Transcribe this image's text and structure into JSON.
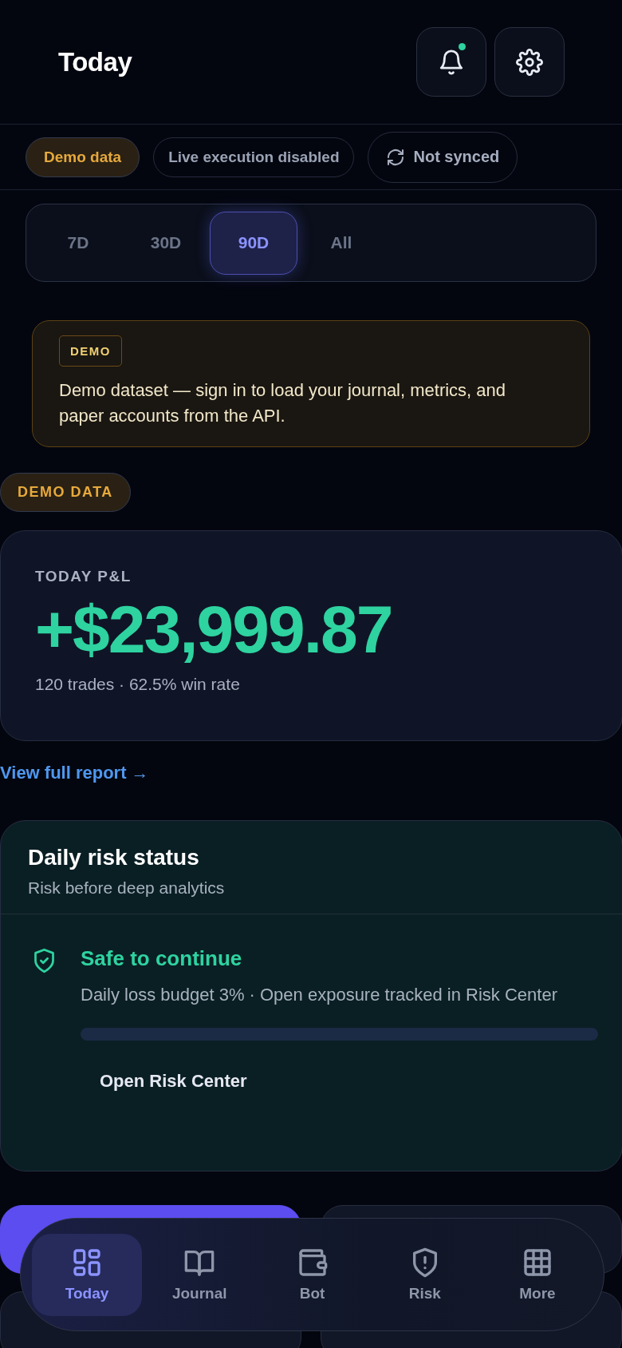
{
  "header": {
    "title": "Today",
    "notifications_unread": true
  },
  "status_chips": [
    {
      "kind": "demo",
      "label": "Demo data"
    },
    {
      "kind": "plain",
      "label": "Live execution disabled"
    },
    {
      "kind": "sync",
      "label": "Not synced"
    }
  ],
  "periods": [
    {
      "label": "7D",
      "selected": false
    },
    {
      "label": "30D",
      "selected": false
    },
    {
      "label": "90D",
      "selected": true
    },
    {
      "label": "All",
      "selected": false
    }
  ],
  "demo_notice": {
    "tag": "DEMO",
    "text": "Demo dataset — sign in to load your journal, metrics, and paper accounts from the API."
  },
  "demo_badge": "DEMO DATA",
  "pnl_card": {
    "title": "TODAY P&L",
    "amount": "+$23,999.87",
    "summary": "120 trades · 62.5% win rate"
  },
  "report_link": "View full report →",
  "risk_card": {
    "title": "Daily risk status",
    "subtitle": "Risk before deep analytics",
    "status": "Safe to continue",
    "detail": "Daily loss budget 3% · Open exposure tracked in Risk Center",
    "button": "Open Risk Center"
  },
  "bottom_nav": [
    {
      "kind": "grid",
      "label": "Today",
      "selected": true
    },
    {
      "kind": "book",
      "label": "Journal",
      "selected": false
    },
    {
      "kind": "wallet",
      "label": "Bot",
      "selected": false
    },
    {
      "kind": "shield",
      "label": "Risk",
      "selected": false
    },
    {
      "kind": "table",
      "label": "More",
      "selected": false
    }
  ]
}
